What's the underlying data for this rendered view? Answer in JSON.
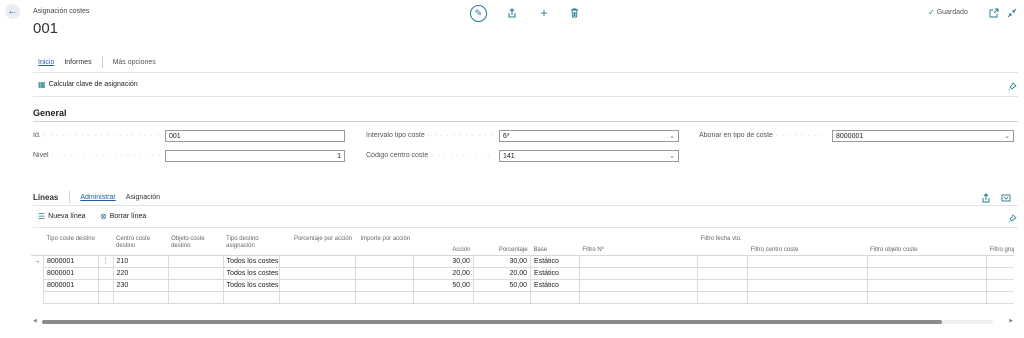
{
  "header": {
    "caption": "Asignación costes",
    "record_id": "001",
    "saved_status": "Guardado"
  },
  "icons": {
    "back": "arrow-left-icon",
    "edit": "pencil-icon",
    "share": "share-icon",
    "new": "plus-icon",
    "delete": "trash-icon",
    "saved_check": "checkmark-icon",
    "open_new_window": "open-window-icon",
    "collapse": "collapse-icon",
    "pin": "pin-icon"
  },
  "action_bar": {
    "tabs": [
      "Inicio",
      "Informes"
    ],
    "more_options": "Más opciones",
    "actions": [
      "Calcular clave de asignación"
    ]
  },
  "general": {
    "title": "General",
    "fields": {
      "id": {
        "label": "Id.",
        "value": "001"
      },
      "nivel": {
        "label": "Nivel",
        "value": "1"
      },
      "intervalo": {
        "label": "Intervalo tipo coste",
        "value": "6*"
      },
      "codigo_cc": {
        "label": "Código centro coste",
        "value": "141"
      },
      "abonar": {
        "label": "Abonar en tipo de coste",
        "value": "8000001"
      }
    }
  },
  "lines": {
    "title": "Líneas",
    "tabs": [
      "Administrar",
      "Asignación"
    ],
    "actions": {
      "new_line": "Nueva línea",
      "delete_line": "Borrar línea"
    },
    "columns": [
      "Tipo coste destino",
      "Centro coste destino",
      "Objeto coste destino",
      "Tipo destino asignación",
      "Porcentaje por acción",
      "Importe por acción",
      "Acción",
      "Porcentaje",
      "Base",
      "Filtro Nº",
      "Filtro fecha vto.",
      "Filtro centro coste",
      "Filtro objeto coste",
      "Filtro grupo"
    ],
    "rows": [
      {
        "tipo": "8000001",
        "centro": "210",
        "objeto": "",
        "destino": "Todos los costes",
        "pct_accion": "",
        "imp_accion": "",
        "accion": "30,00",
        "porcentaje": "30,00",
        "base": "Estático"
      },
      {
        "tipo": "8000001",
        "centro": "220",
        "objeto": "",
        "destino": "Todos los costes",
        "pct_accion": "",
        "imp_accion": "",
        "accion": "20,00",
        "porcentaje": "20,00",
        "base": "Estático"
      },
      {
        "tipo": "8000001",
        "centro": "230",
        "objeto": "",
        "destino": "Todos los costes",
        "pct_accion": "",
        "imp_accion": "",
        "accion": "50,00",
        "porcentaje": "50,00",
        "base": "Estático"
      },
      {
        "tipo": "",
        "centro": "",
        "objeto": "",
        "destino": "",
        "pct_accion": "",
        "imp_accion": "",
        "accion": "",
        "porcentaje": "",
        "base": ""
      }
    ],
    "selected_row_indicator": "→"
  },
  "colors": {
    "accent": "#1f7a8c",
    "link": "#1f5fa8"
  }
}
